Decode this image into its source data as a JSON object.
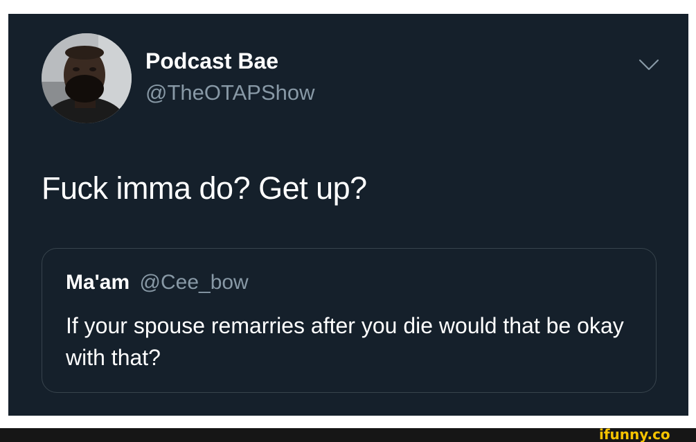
{
  "tweet": {
    "display_name": "Podcast Bae",
    "handle": "@TheOTAPShow",
    "text": "Fuck imma do? Get up?",
    "avatar_icon": "profile-photo",
    "menu_icon": "chevron-down-icon"
  },
  "quoted_tweet": {
    "display_name": "Ma'am",
    "handle": "@Cee_bow",
    "text": "If your spouse remarries after you die would that be okay with that?"
  },
  "watermark": {
    "text": "ifunny.co",
    "color": "#f6c300"
  },
  "colors": {
    "card_background": "#15202b",
    "secondary_text": "#8899a6",
    "border": "#38444d",
    "footer_bar": "#161616"
  }
}
